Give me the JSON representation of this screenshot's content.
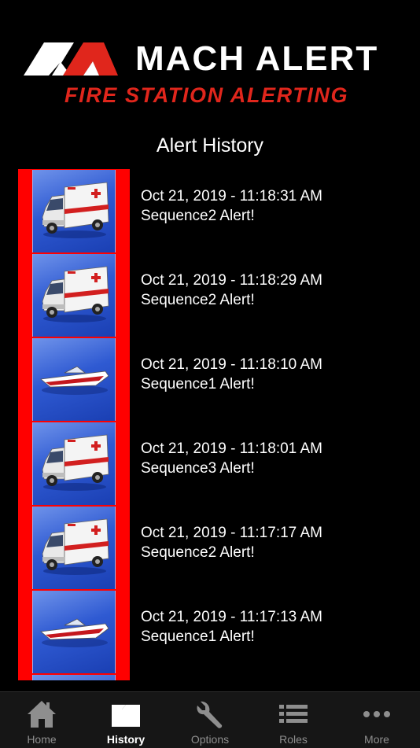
{
  "header": {
    "logo_title": "MACH ALERT",
    "logo_subtitle": "FIRE STATION ALERTING",
    "brand_red": "#e0261c"
  },
  "page_title": "Alert History",
  "alerts": [
    {
      "timestamp": "Oct 21, 2019 - 11:18:31 AM",
      "message": "Sequence2 Alert!",
      "icon": "ambulance-icon"
    },
    {
      "timestamp": "Oct 21, 2019 - 11:18:29 AM",
      "message": "Sequence2 Alert!",
      "icon": "ambulance-icon"
    },
    {
      "timestamp": "Oct 21, 2019 - 11:18:10 AM",
      "message": "Sequence1 Alert!",
      "icon": "boat-icon"
    },
    {
      "timestamp": "Oct 21, 2019 - 11:18:01 AM",
      "message": "Sequence3 Alert!",
      "icon": "ambulance-icon"
    },
    {
      "timestamp": "Oct 21, 2019 - 11:17:17 AM",
      "message": "Sequence2 Alert!",
      "icon": "ambulance-icon"
    },
    {
      "timestamp": "Oct 21, 2019 - 11:17:13 AM",
      "message": "Sequence1 Alert!",
      "icon": "boat-icon"
    }
  ],
  "tabs": [
    {
      "label": "Home",
      "icon": "home-icon",
      "active": false
    },
    {
      "label": "History",
      "icon": "folder-icon",
      "active": true
    },
    {
      "label": "Options",
      "icon": "wrench-icon",
      "active": false
    },
    {
      "label": "Roles",
      "icon": "list-icon",
      "active": false
    },
    {
      "label": "More",
      "icon": "more-icon",
      "active": false
    }
  ]
}
